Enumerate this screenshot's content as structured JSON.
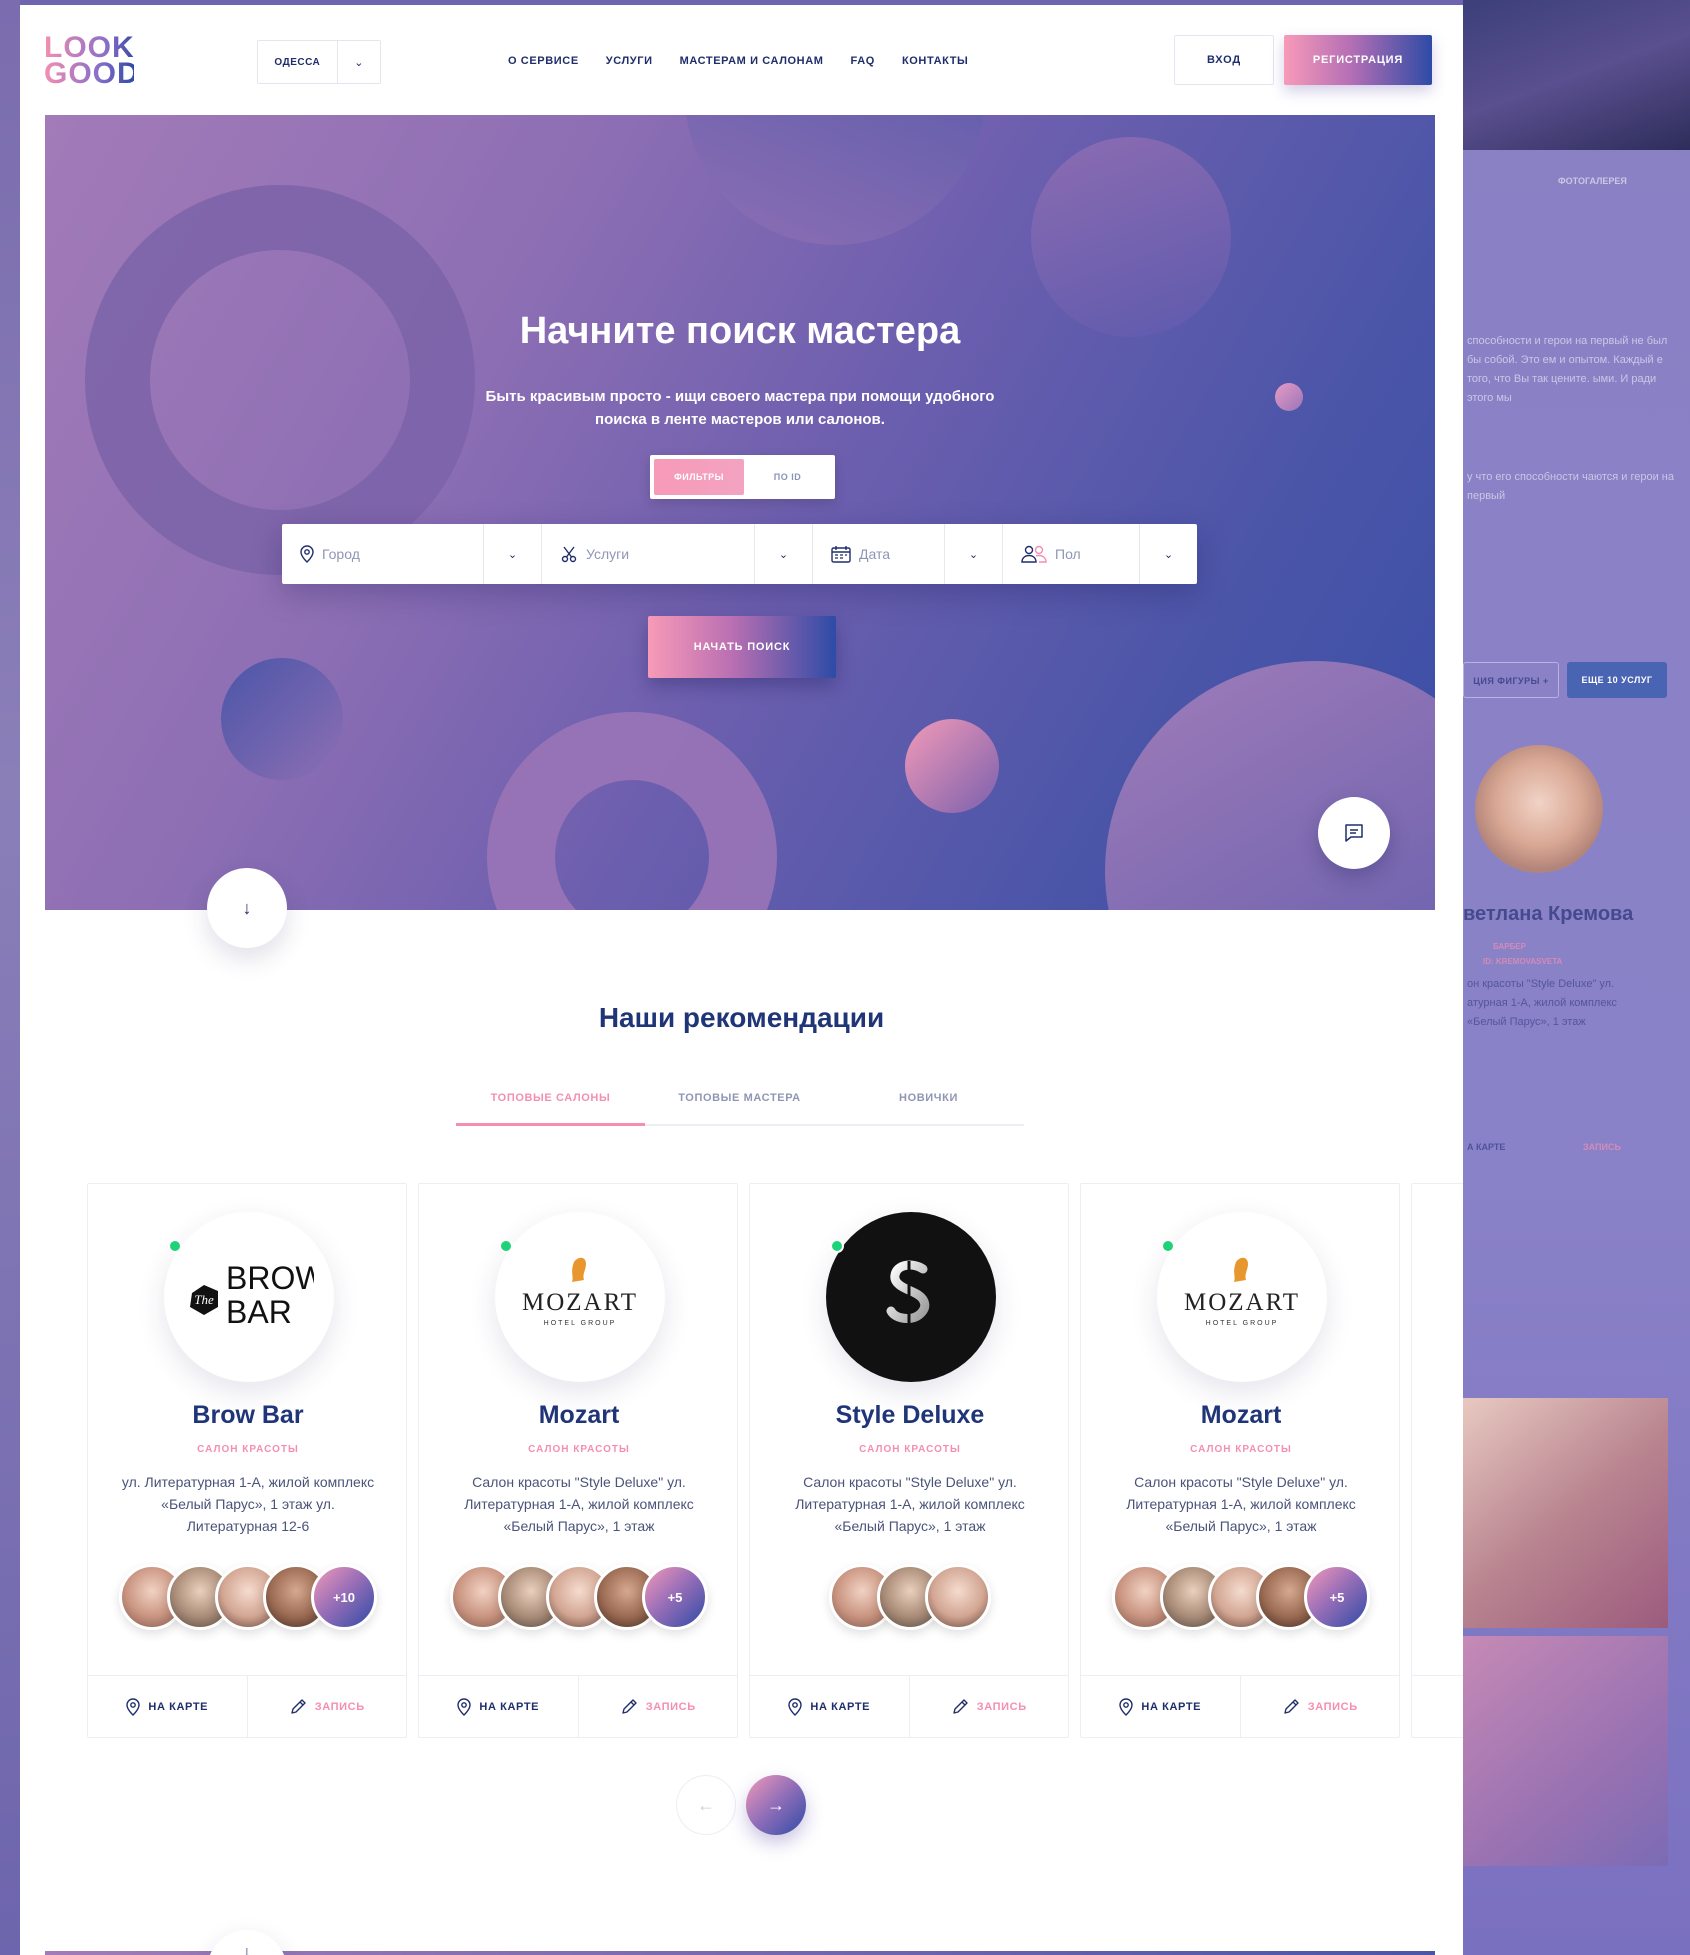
{
  "header": {
    "logo_line1": "LOOK",
    "logo_line2": "GOOD",
    "city": "ОДЕССА",
    "nav": [
      "О СЕРВИСЕ",
      "УСЛУГИ",
      "МАСТЕРАМ И САЛОНАМ",
      "FAQ",
      "КОНТАКТЫ"
    ],
    "login": "ВХОД",
    "register": "РЕГИСТРАЦИЯ"
  },
  "hero": {
    "title": "Начните поиск мастера",
    "subtitle": "Быть красивым просто - ищи своего мастера при помощи удобного поиска в ленте мастеров или салонов.",
    "toggle_on": "ФИЛЬТРЫ",
    "toggle_off": "ПО ID",
    "fields": {
      "city": "Город",
      "services": "Услуги",
      "date": "Дата",
      "gender": "Пол"
    },
    "search_button": "НАЧАТЬ ПОИСК"
  },
  "recommendations": {
    "title": "Наши рекомендации",
    "tabs": [
      "ТОПОВЫЕ САЛОНЫ",
      "ТОПОВЫЕ МАСТЕРА",
      "НОВИЧКИ"
    ],
    "cards": [
      {
        "name": "Brow Bar",
        "type": "САЛОН КРАСОТЫ",
        "address": "ул. Литературная 1-А, жилой комплекс «Белый Парус», 1 этаж ул. Литературная 12-6",
        "more": "+10",
        "map": "НА КАРТЕ",
        "book": "ЗАПИСЬ"
      },
      {
        "name": "Mozart",
        "type": "САЛОН КРАСОТЫ",
        "address": "Салон красоты \"Style Deluxe\" ул. Литературная 1-А, жилой комплекс «Белый Парус», 1 этаж",
        "more": "+5",
        "map": "НА КАРТЕ",
        "book": "ЗАПИСЬ"
      },
      {
        "name": "Style Deluxe",
        "type": "САЛОН КРАСОТЫ",
        "address": "Салон красоты \"Style Deluxe\" ул. Литературная 1-А, жилой комплекс «Белый Парус», 1 этаж",
        "more": "",
        "map": "НА КАРТЕ",
        "book": "ЗАПИСЬ"
      },
      {
        "name": "Mozart",
        "type": "САЛОН КРАСОТЫ",
        "address": "Салон красоты \"Style Deluxe\" ул. Литературная 1-А, жилой комплекс «Белый Парус», 1 этаж",
        "more": "+5",
        "map": "НА КАРТЕ",
        "book": "ЗАПИСЬ"
      }
    ],
    "logo_text": {
      "browbar_the": "The",
      "browbar_1": "BROW",
      "browbar_2": "BAR",
      "mozart": "MOZART",
      "mozart_sub": "HOTEL GROUP"
    }
  },
  "background_right": {
    "gallery_label": "ФОТОГАЛЕРЕЯ",
    "text_block": "способности и герои на первый не был бы собой. Это ем и опытом. Каждый е того, что Вы так цените. ыми. И ради этого мы",
    "text_block2": "у что его способности чаются и герои на первый",
    "btn1": "ЦИЯ ФИГУРЫ +",
    "btn2": "ЕЩЕ 10 УСЛУГ",
    "person_name": "ветлана Кремова",
    "person_role": "БАРБЕР",
    "person_handle": "ID: KREMOVASVETA",
    "person_address": "он красоты \"Style Deluxe\" ул. атурная 1-А, жилой комплекс «Белый Парус», 1 этаж",
    "map": "А КАРТЕ",
    "book": "ЗАПИСЬ"
  },
  "colors": {
    "navy": "#1f3578",
    "pink": "#f48fb1",
    "online": "#1ed27a"
  }
}
